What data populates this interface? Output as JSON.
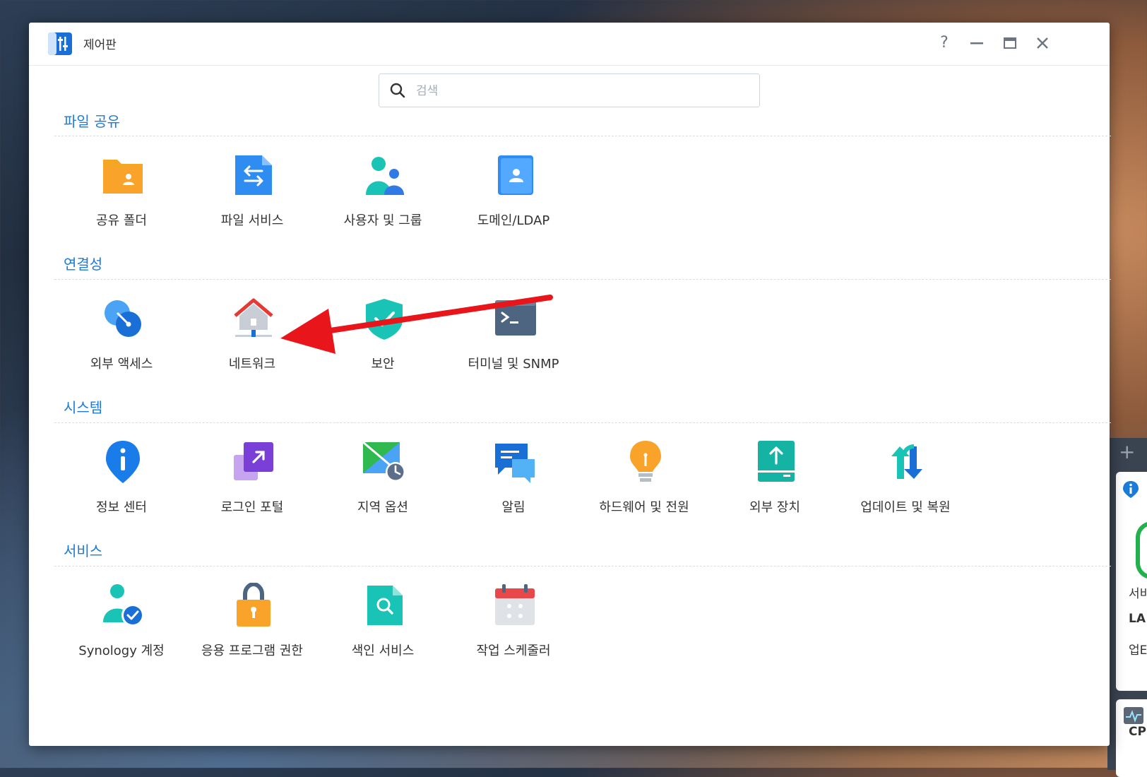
{
  "window": {
    "title": "제어판",
    "help_label": "?",
    "minimize_label": "—",
    "close_label": "✕"
  },
  "search": {
    "placeholder": "검색",
    "value": ""
  },
  "sections": [
    {
      "title": "파일 공유",
      "items": [
        "공유 폴더",
        "파일 서비스",
        "사용자 및 그룹",
        "도메인/LDAP"
      ]
    },
    {
      "title": "연결성",
      "items": [
        "외부 액세스",
        "네트워크",
        "보안",
        "터미널 및 SNMP"
      ]
    },
    {
      "title": "시스템",
      "items": [
        "정보 센터",
        "로그인 포털",
        "지역 옵션",
        "알림",
        "하드웨어 및 전원",
        "외부 장치",
        "업데이트 및 복원"
      ]
    },
    {
      "title": "서비스",
      "items": [
        "Synology 계정",
        "응용 프로그램 권한",
        "색인 서비스",
        "작업 스케줄러"
      ]
    }
  ],
  "side_widget": {
    "plus_label": "+",
    "text1": "서비",
    "text2": "LA",
    "text3": "업E",
    "text4": "CP"
  },
  "colors": {
    "accent": "#1b7bd8",
    "arrow": "#e8161b"
  }
}
